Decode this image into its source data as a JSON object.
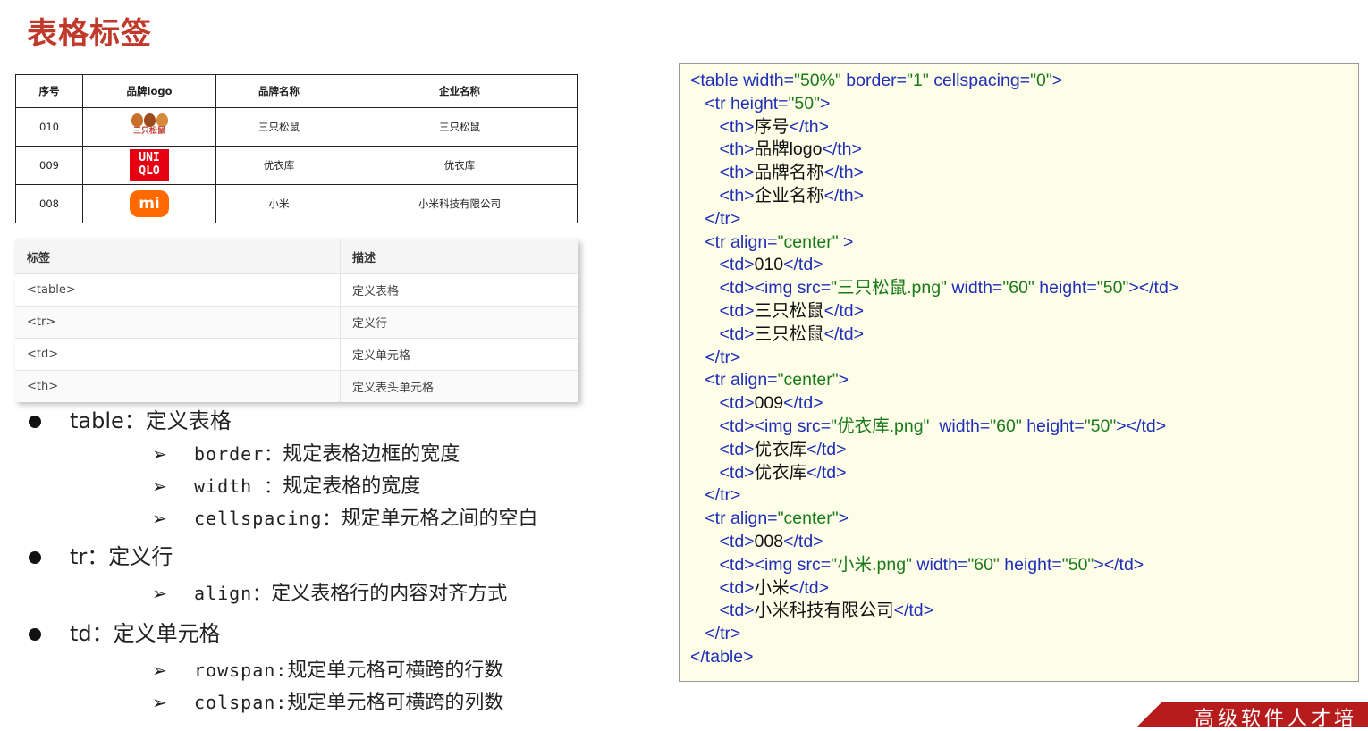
{
  "title": "表格标签",
  "brands": {
    "headers": [
      "序号",
      "品牌logo",
      "品牌名称",
      "企业名称"
    ],
    "rows": [
      {
        "id": "010",
        "logo": "三只松鼠",
        "name": "三只松鼠",
        "company": "三只松鼠"
      },
      {
        "id": "009",
        "logo_lines": [
          "UNI",
          "QLO"
        ],
        "name": "优衣库",
        "company": "优衣库"
      },
      {
        "id": "008",
        "logo": "mi",
        "name": "小米",
        "company": "小米科技有限公司"
      }
    ]
  },
  "tags": {
    "headers": [
      "标签",
      "描述"
    ],
    "rows": [
      {
        "tag": "<table>",
        "desc": "定义表格"
      },
      {
        "tag": "<tr>",
        "desc": "定义行"
      },
      {
        "tag": "<td>",
        "desc": "定义单元格"
      },
      {
        "tag": "<th>",
        "desc": "定义表头单元格"
      }
    ]
  },
  "bullets": {
    "table": {
      "label": "table：定义表格",
      "items": [
        [
          "border：",
          "规定表格边框的宽度"
        ],
        [
          "width ：",
          "规定表格的宽度"
        ],
        [
          "cellspacing：",
          "规定单元格之间的空白"
        ]
      ]
    },
    "tr": {
      "label": "tr：定义行",
      "items": [
        [
          "align：",
          "定义表格行的内容对齐方式"
        ]
      ]
    },
    "td": {
      "label": "td：定义单元格",
      "items": [
        [
          "rowspan:",
          "规定单元格可横跨的行数"
        ],
        [
          "colspan:",
          "规定单元格可横跨的列数"
        ]
      ]
    }
  },
  "code": {
    "l1": [
      "<table width=",
      "\"50%\"",
      " border=",
      "\"1\"",
      " cellspacing=",
      "\"0\"",
      ">"
    ],
    "l2": [
      "<tr height=",
      "\"50\"",
      ">"
    ],
    "th1": "序号",
    "th2": "品牌logo",
    "th3": "品牌名称",
    "th4": "企业名称",
    "tr_close": "</tr>",
    "tr_center": [
      "<tr align=",
      "\"center\"",
      " >"
    ],
    "tr_center2": [
      "<tr align=",
      "\"center\"",
      ">"
    ],
    "d010": "010",
    "img1": "\"三只松鼠.png\"",
    "sz": "三只松鼠",
    "d009": "009",
    "img2": "\"优衣库.png\"",
    "yyk": "优衣库",
    "d008": "008",
    "img3": "\"小米.png\"",
    "xm": "小米",
    "xmco": "小米科技有限公司",
    "w60": "\"60\"",
    "h50": "\"50\"",
    "table_close": "</table>"
  },
  "banner": "高级软件人才培"
}
